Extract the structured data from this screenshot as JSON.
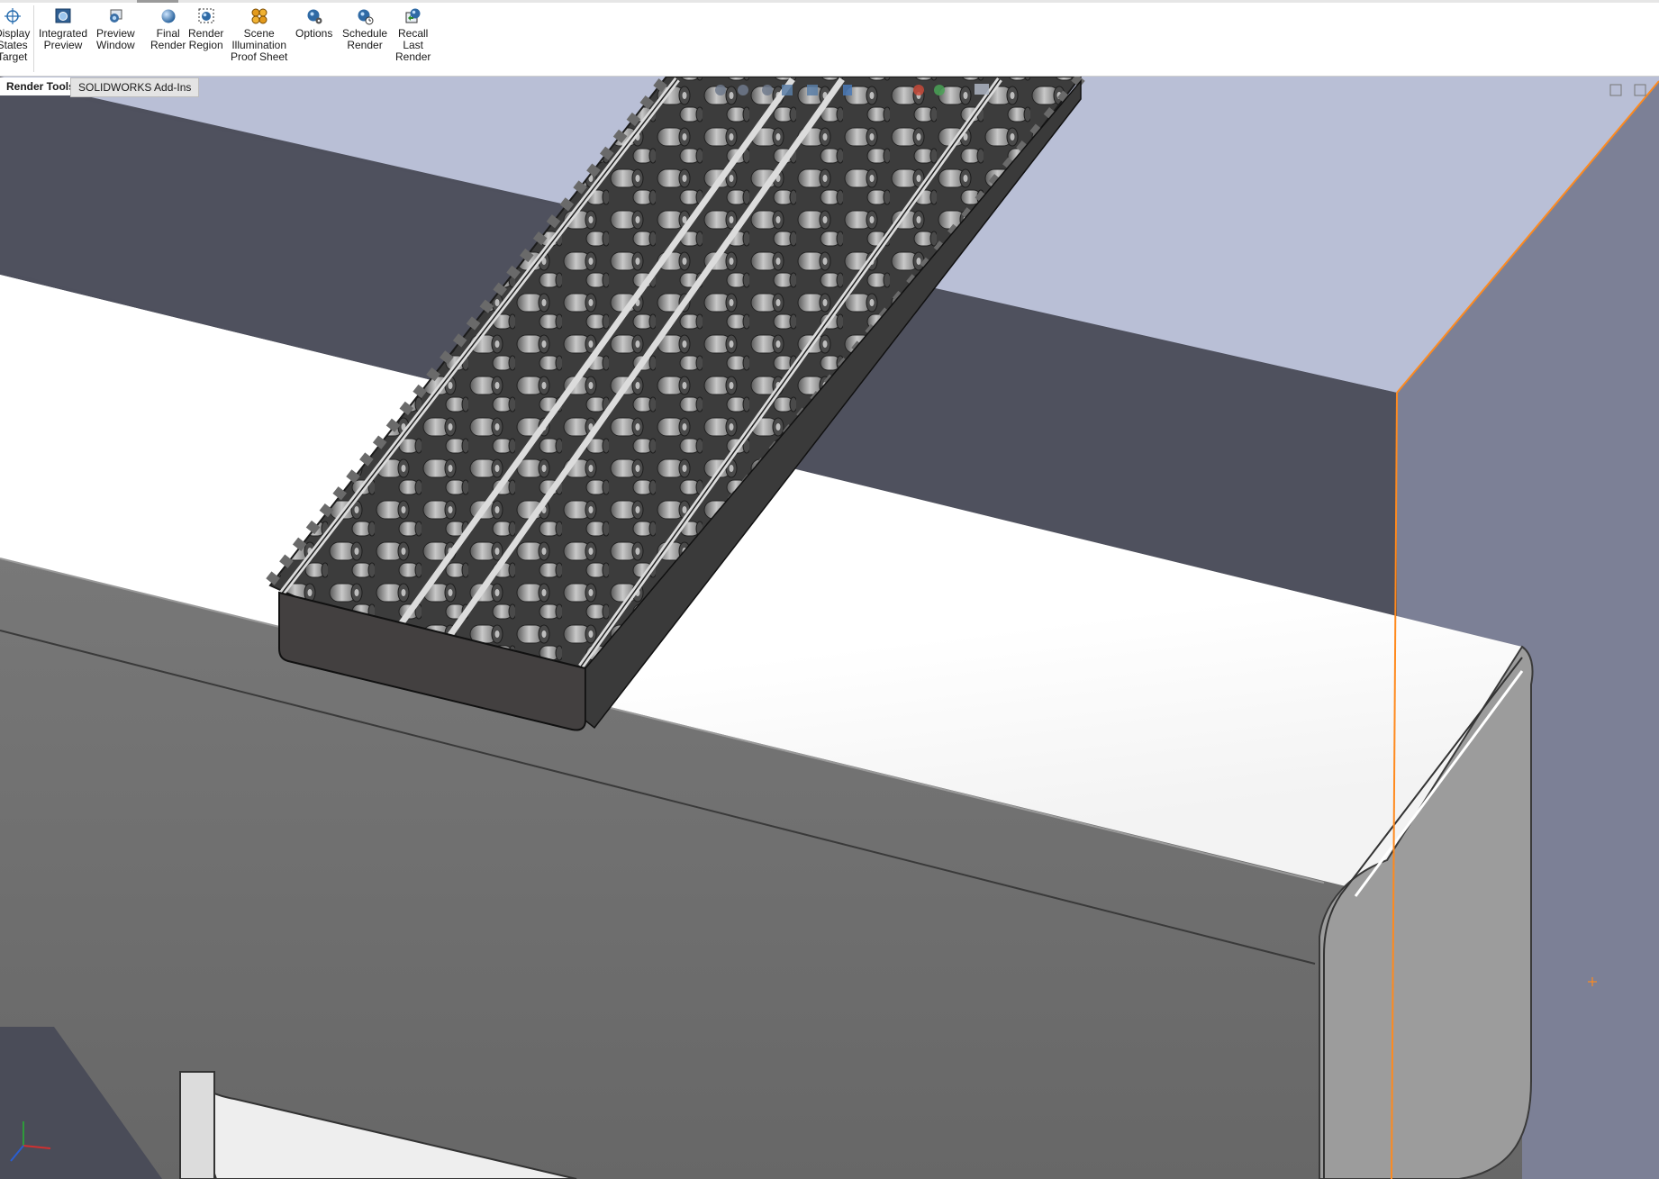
{
  "ribbon": {
    "buttons": [
      {
        "id": "display-states-target",
        "lines": [
          "Display",
          "States",
          "Target"
        ]
      },
      {
        "id": "integrated-preview",
        "lines": [
          "Integrated",
          "Preview"
        ]
      },
      {
        "id": "preview-window",
        "lines": [
          "Preview",
          "Window"
        ]
      },
      {
        "id": "final-render",
        "lines": [
          "Final",
          "Render"
        ]
      },
      {
        "id": "render-region",
        "lines": [
          "Render",
          "Region"
        ]
      },
      {
        "id": "scene-illumination-proof-sheet",
        "lines": [
          "Scene",
          "Illumination",
          "Proof Sheet"
        ]
      },
      {
        "id": "options",
        "lines": [
          "Options"
        ]
      },
      {
        "id": "schedule-render",
        "lines": [
          "Schedule",
          "Render"
        ]
      },
      {
        "id": "recall-last-render",
        "lines": [
          "Recall",
          "Last",
          "Render"
        ]
      }
    ]
  },
  "tabs": {
    "render_tools": "Render Tools",
    "solidworks_addins": "SOLIDWORKS Add-Ins"
  },
  "colors": {
    "background": "#5a5e6a",
    "backwall": "#b9bfd6",
    "edge_highlight": "#ff8a1e",
    "ribbon": "#ffffff"
  }
}
